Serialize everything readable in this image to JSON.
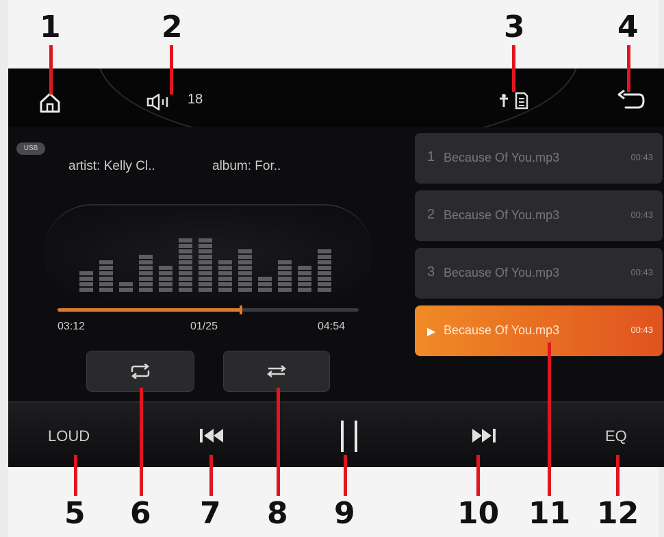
{
  "topbar": {
    "volume_value": "18",
    "icons": [
      "home-icon",
      "volume-icon",
      "usb-icon",
      "sd-card-icon",
      "back-icon"
    ]
  },
  "song": {
    "source_badge": "USB",
    "artist": "artist: Kelly Cl..",
    "album": "album: For..",
    "time_elapsed": "03:12",
    "track_index": "01/25",
    "time_total": "04:54",
    "progress_fraction": 0.61
  },
  "equalizer_levels": [
    4,
    6,
    2,
    7,
    5,
    10,
    10,
    6,
    8,
    3,
    6,
    5,
    8
  ],
  "playlist": [
    {
      "num": "1",
      "title": "Because Of You.mp3",
      "duration": "00:43",
      "active": false
    },
    {
      "num": "2",
      "title": "Because Of You.mp3",
      "duration": "00:43",
      "active": false
    },
    {
      "num": "3",
      "title": "Because Of You.mp3",
      "duration": "00:43",
      "active": false
    },
    {
      "num": "",
      "title": "Because Of You.mp3",
      "duration": "00:43",
      "active": true
    }
  ],
  "bottombar": {
    "loud_label": "LOUD",
    "eq_label": "EQ"
  },
  "callouts": [
    "1",
    "2",
    "3",
    "4",
    "5",
    "6",
    "7",
    "8",
    "9",
    "10",
    "11",
    "12"
  ],
  "colors": {
    "accent": "#e07a2e",
    "active_item": "#f08a26",
    "callout_line": "#e0161e"
  }
}
